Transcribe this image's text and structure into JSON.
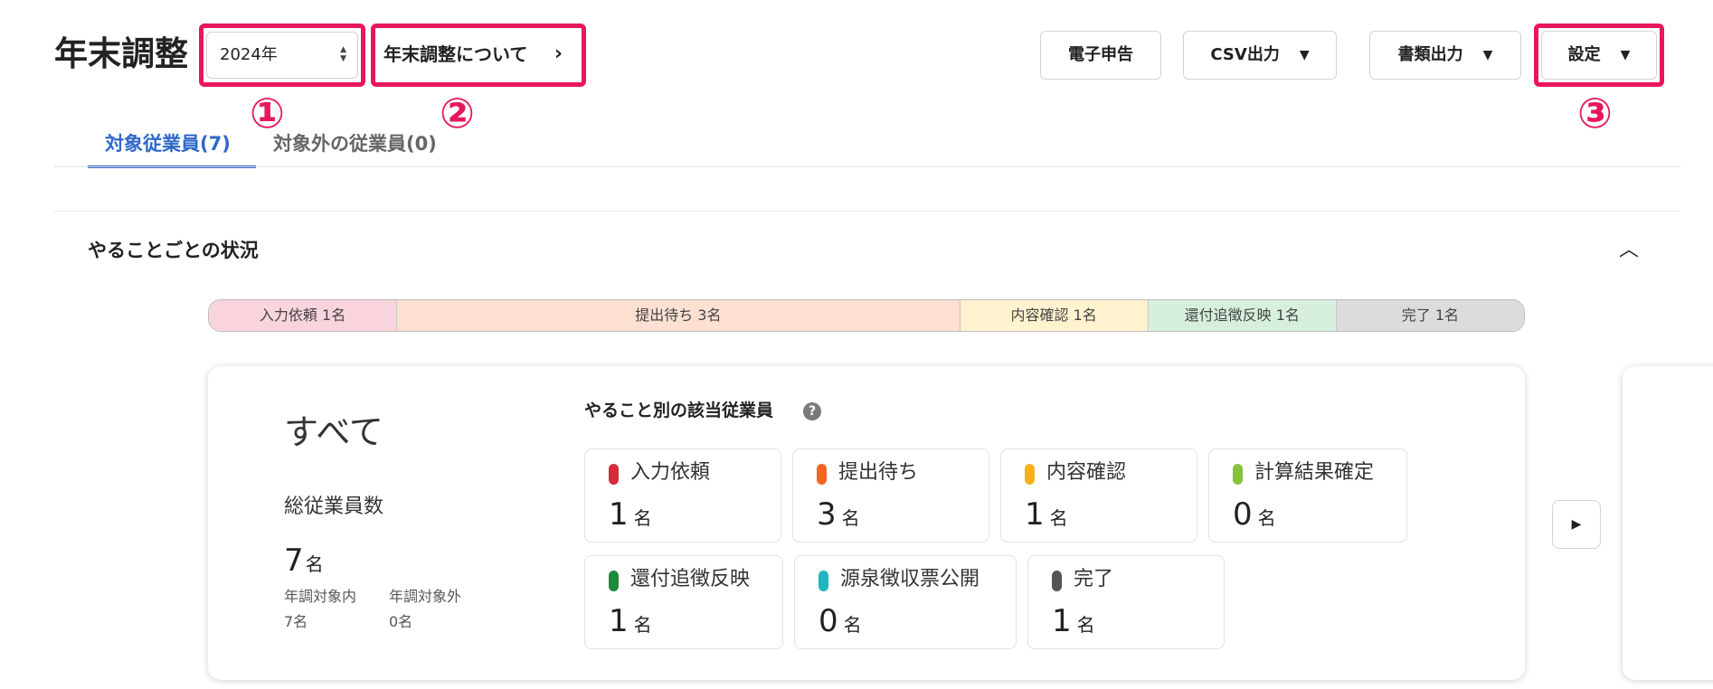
{
  "header": {
    "title": "年末調整",
    "year": "2024年",
    "about_link": "年末調整について",
    "buttons": {
      "efile": "電子申告",
      "csv": "CSV出力",
      "docs": "書類出力",
      "settings": "設定"
    }
  },
  "callouts": [
    "①",
    "②",
    "③"
  ],
  "tabs": [
    {
      "label": "対象従業員(7)",
      "active": true
    },
    {
      "label": "対象外の従業員(0)",
      "active": false
    }
  ],
  "section": {
    "title": "やることごとの状況"
  },
  "progress": [
    {
      "label": "入力依頼 1名",
      "count": 1,
      "color": "#fad4dc"
    },
    {
      "label": "提出待ち 3名",
      "count": 3,
      "color": "#fde0d2"
    },
    {
      "label": "内容確認 1名",
      "count": 1,
      "color": "#fff2cf"
    },
    {
      "label": "還付追徴反映 1名",
      "count": 1,
      "color": "#d7f0dd"
    },
    {
      "label": "完了 1名",
      "count": 1,
      "color": "#dcdcdc"
    }
  ],
  "summary": {
    "title": "すべて",
    "total_label": "総従業員数",
    "total_value": "7",
    "unit": "名",
    "in_scope_label": "年調対象内",
    "in_scope_value": "7名",
    "out_scope_label": "年調対象外",
    "out_scope_value": "0名"
  },
  "by_task": {
    "title": "やること別の該当従業員",
    "help": "?",
    "unit": "名",
    "items": [
      {
        "label": "入力依頼",
        "value": "1",
        "color": "#d62b3a"
      },
      {
        "label": "提出待ち",
        "value": "3",
        "color": "#f26522"
      },
      {
        "label": "内容確認",
        "value": "1",
        "color": "#f6b21b"
      },
      {
        "label": "計算結果確定",
        "value": "0",
        "color": "#86c23c"
      },
      {
        "label": "還付追徴反映",
        "value": "1",
        "color": "#1e8a3c"
      },
      {
        "label": "源泉徴収票公開",
        "value": "0",
        "color": "#1fb5c1"
      },
      {
        "label": "完了",
        "value": "1",
        "color": "#555555"
      }
    ]
  },
  "icons": {
    "year_select": "updown-arrows-icon",
    "about_chevron": "chevron-right-icon",
    "dropdown": "caret-down-icon",
    "collapse": "chevron-up-icon",
    "next": "play-right-icon",
    "help": "question-circle-icon"
  }
}
